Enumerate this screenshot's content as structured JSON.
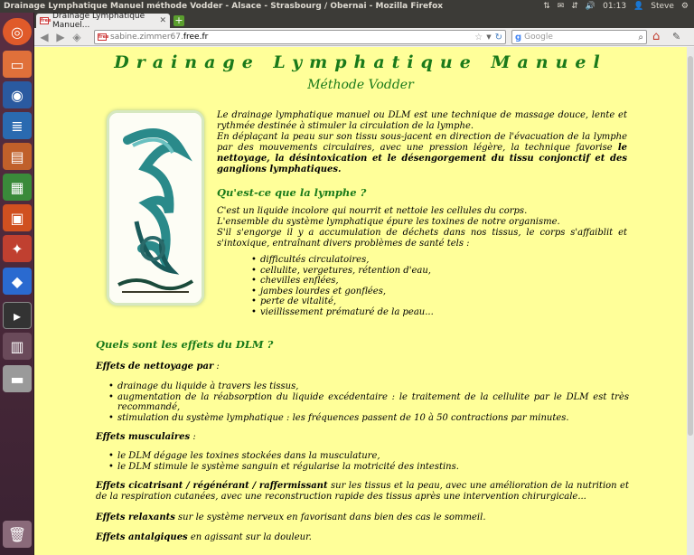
{
  "window": {
    "title": "Drainage Lymphatique Manuel méthode Vodder - Alsace - Strasbourg / Obernai - Mozilla Firefox",
    "clock": "01:13",
    "user": "Steve"
  },
  "browser": {
    "tab_label": "Drainage Lymphatique Manuel...",
    "favicon_text": "free",
    "url_prefix": "sabine.zimmer67.",
    "url_host": "free.fr",
    "search_placeholder": "Google"
  },
  "page": {
    "title": "Drainage Lymphatique Manuel",
    "subtitle": "Méthode Vodder",
    "intro_1": "Le drainage lymphatique manuel ou DLM est une technique de massage douce, lente et rythmée destinée à stimuler la circulation de la lymphe.",
    "intro_2a": "En déplaçant la peau sur son tissu sous-jacent en direction de l'évacuation de la lymphe par des mouvements circulaires, avec une pression légère, la technique favorise ",
    "intro_2b": "le nettoyage, la désintoxication et le désengorgement du tissu conjonctif et des ganglions lymphatiques.",
    "lymph_title": "Qu'est-ce que la lymphe ?",
    "lymph_1": "C'est un liquide incolore qui nourrit et nettoie les cellules du corps.",
    "lymph_2": "L'ensemble du système lymphatique épure les toxines de notre organisme.",
    "lymph_3": "S'il s'engorge il y a accumulation de déchets dans nos tissus, le corps s'affaiblit et s'intoxique, entraînant divers problèmes de santé tels :",
    "problems": [
      "difficultés circulatoires,",
      "cellulite, vergetures, rétention d'eau,",
      "chevilles enflées,",
      "jambes lourdes et gonflées,",
      "perte de vitalité,",
      "vieillissement prématuré de la peau..."
    ],
    "effects_title": "Quels sont les effets du DLM ?",
    "nettoyage_label": "Effets de nettoyage par",
    "nettoyage_suffix": " :",
    "nettoyage_items": [
      "drainage du liquide à travers les tissus,",
      "augmentation de la réabsorption du liquide excédentaire : le traitement de la cellulite par le DLM est très recommandé,",
      "stimulation du système lymphatique : les fréquences passent de 10 à 50 contractions par minutes."
    ],
    "musculaires_label": "Effets musculaires",
    "musculaires_suffix": " :",
    "musculaires_items": [
      "le DLM dégage les toxines stockées dans la musculature,",
      "le DLM stimule le système sanguin et régularise la motricité des intestins."
    ],
    "cicatrisant_label": "Effets cicatrisant / régénérant / raffermissant",
    "cicatrisant_text": " sur les tissus et la peau, avec une amélioration de la nutrition et de la respiration cutanées, avec une reconstruction rapide des tissus après une intervention chirurgicale...",
    "relaxants_label": "Effets relaxants",
    "relaxants_text": " sur le système nerveux en favorisant dans bien des cas le sommeil.",
    "antalgiques_label": "Effets antalgiques",
    "antalgiques_text": " en agissant sur la douleur."
  },
  "colors": {
    "page_background": "#ffff99",
    "heading_green": "#1a7a1a"
  }
}
